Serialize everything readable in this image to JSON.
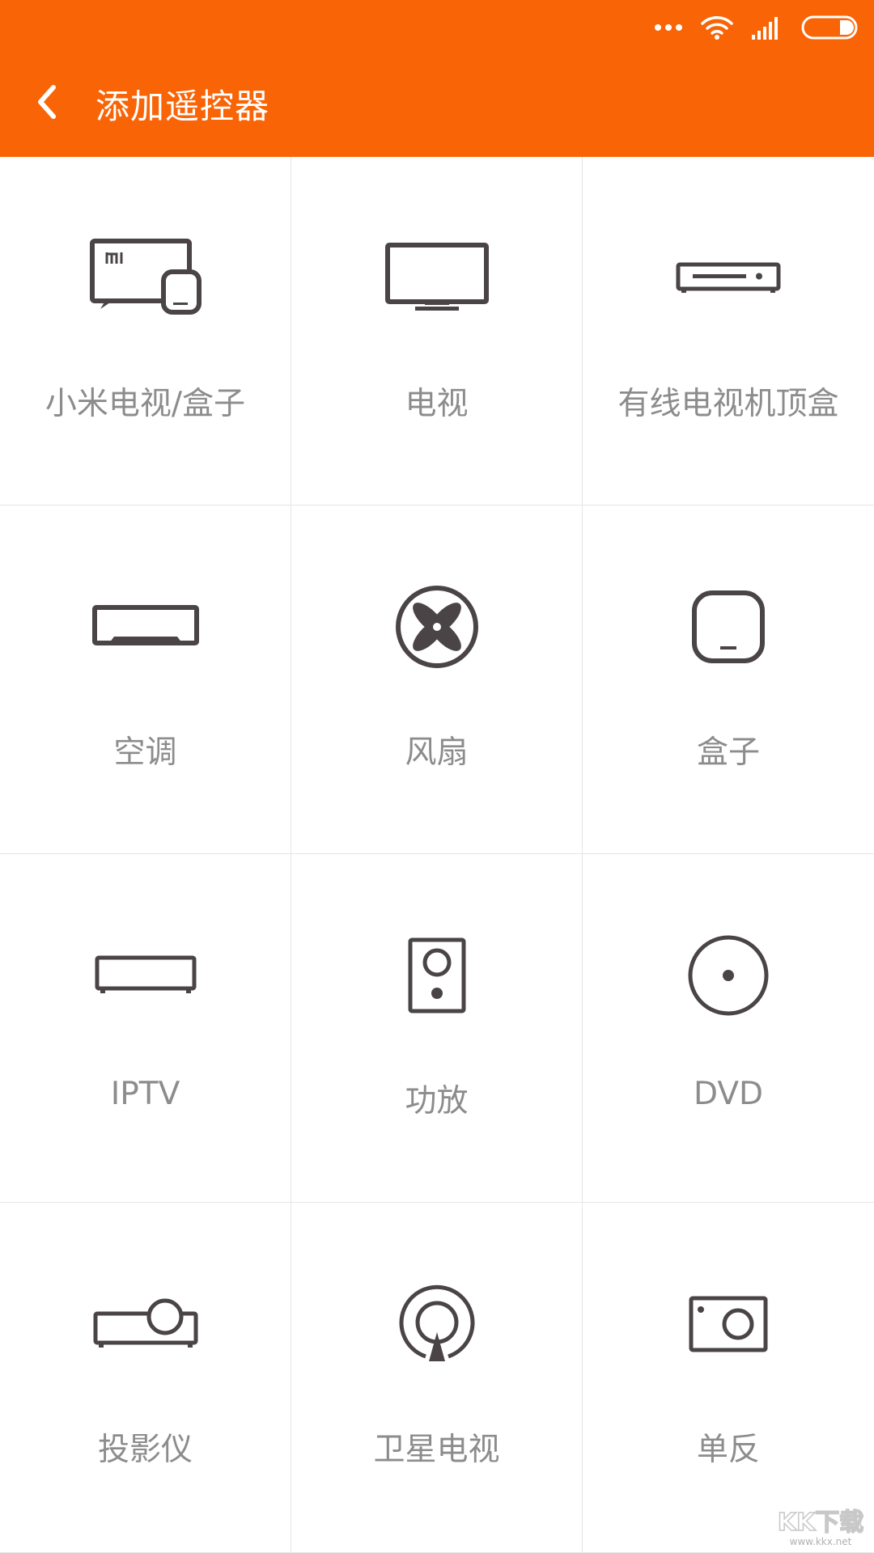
{
  "header": {
    "title": "添加遥控器",
    "bg_color": "#f86406"
  },
  "status_icons": [
    "more-dots-icon",
    "wifi-icon",
    "signal-icon",
    "battery-icon"
  ],
  "devices": [
    {
      "label": "小米电视/盒子",
      "icon": "mi-tv-box-icon"
    },
    {
      "label": "电视",
      "icon": "tv-icon"
    },
    {
      "label": "有线电视机顶盒",
      "icon": "set-top-box-icon"
    },
    {
      "label": "空调",
      "icon": "air-conditioner-icon"
    },
    {
      "label": "风扇",
      "icon": "fan-icon"
    },
    {
      "label": "盒子",
      "icon": "box-icon"
    },
    {
      "label": "IPTV",
      "icon": "iptv-icon"
    },
    {
      "label": "功放",
      "icon": "speaker-icon"
    },
    {
      "label": "DVD",
      "icon": "dvd-icon"
    },
    {
      "label": "投影仪",
      "icon": "projector-icon"
    },
    {
      "label": "卫星电视",
      "icon": "satellite-icon"
    },
    {
      "label": "单反",
      "icon": "camera-icon"
    }
  ],
  "watermark": {
    "text": "KK下载",
    "url": "www.kkx.net"
  },
  "colors": {
    "icon_stroke": "#4a4446",
    "label": "#8c8c8c",
    "divider": "#e6e6e6"
  }
}
